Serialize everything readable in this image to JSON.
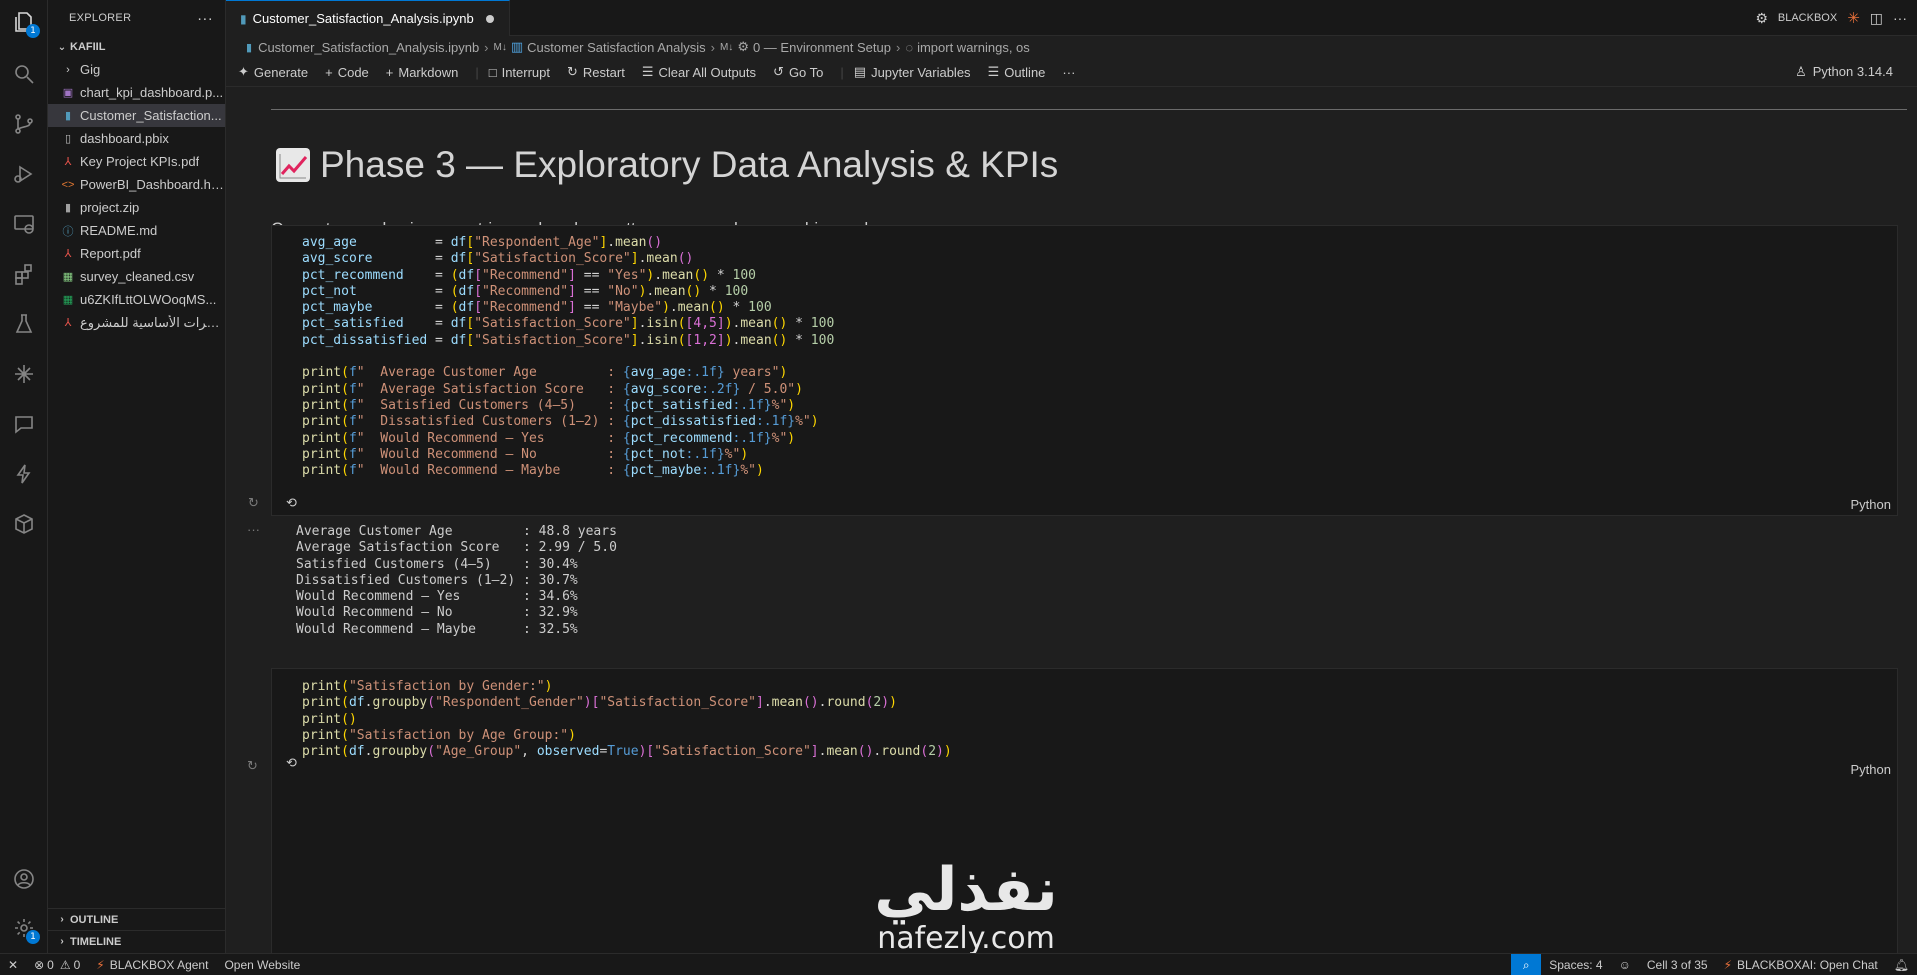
{
  "sidebar": {
    "title": "EXPLORER",
    "section": "KAFIIL",
    "items": [
      {
        "name": "Gig",
        "type": "folder"
      },
      {
        "name": "chart_kpi_dashboard.p...",
        "type": "image"
      },
      {
        "name": "Customer_Satisfaction...",
        "type": "notebook",
        "selected": true
      },
      {
        "name": "dashboard.pbix",
        "type": "file"
      },
      {
        "name": "Key Project KPIs.pdf",
        "type": "pdf"
      },
      {
        "name": "PowerBI_Dashboard.ht...",
        "type": "html"
      },
      {
        "name": "project.zip",
        "type": "zip"
      },
      {
        "name": "README.md",
        "type": "info"
      },
      {
        "name": "Report.pdf",
        "type": "pdf"
      },
      {
        "name": "survey_cleaned.csv",
        "type": "csv"
      },
      {
        "name": "u6ZKIfLttOLWOoqMS...",
        "type": "xlsx"
      },
      {
        "name": "مؤشرات الأساسية للمشروع",
        "type": "pdf"
      }
    ],
    "outline": "OUTLINE",
    "timeline": "TIMELINE"
  },
  "activity_badges": {
    "explorer": "1",
    "settings": "1"
  },
  "tab": {
    "title": "Customer_Satisfaction_Analysis.ipynb"
  },
  "tab_right": {
    "label": "BLACKBOX"
  },
  "breadcrumb": [
    "Customer_Satisfaction_Analysis.ipynb",
    "Customer Satisfaction Analysis",
    "0 — Environment Setup",
    "import warnings, os"
  ],
  "toolbar": {
    "generate": "Generate",
    "code": "Code",
    "markdown": "Markdown",
    "interrupt": "Interrupt",
    "restart": "Restart",
    "clear": "Clear All Outputs",
    "goto": "Go To",
    "variables": "Jupyter Variables",
    "outline": "Outline",
    "more": "···",
    "kernel": "Python 3.14.4"
  },
  "markdown": {
    "heading": "Phase 3 — Exploratory Data Analysis & KPIs",
    "paragraph": "Compute core business metrics and explore patterns across demographics and scores."
  },
  "cell1": {
    "lang": "Python",
    "assign": [
      {
        "var": "avg_age         ",
        "col": "\"Respondent_Age\"",
        "tail": "mean()"
      },
      {
        "var": "avg_score       ",
        "col": "\"Satisfaction_Score\"",
        "tail": "mean()"
      }
    ],
    "pct": [
      {
        "var": "pct_recommend   ",
        "val": "\"Yes\""
      },
      {
        "var": "pct_not         ",
        "val": "\"No\""
      },
      {
        "var": "pct_maybe       ",
        "val": "\"Maybe\""
      }
    ],
    "isin": [
      {
        "var": "pct_satisfied   ",
        "list": "[4,5]"
      },
      {
        "var": "pct_dissatisfied",
        "list": "[1,2]"
      }
    ],
    "prints": [
      {
        "label": "  Average Customer Age         : ",
        "expr": "avg_age",
        "fmt": ":.1f",
        "tail": " years"
      },
      {
        "label": "  Average Satisfaction Score   : ",
        "expr": "avg_score",
        "fmt": ":.2f",
        "tail": " / 5.0"
      },
      {
        "label": "  Satisfied Customers (4–5)    : ",
        "expr": "pct_satisfied",
        "fmt": ":.1f",
        "tail": "%"
      },
      {
        "label": "  Dissatisfied Customers (1–2) : ",
        "expr": "pct_dissatisfied",
        "fmt": ":.1f",
        "tail": "%"
      },
      {
        "label": "  Would Recommend — Yes        : ",
        "expr": "pct_recommend",
        "fmt": ":.1f",
        "tail": "%"
      },
      {
        "label": "  Would Recommend — No         : ",
        "expr": "pct_not",
        "fmt": ":.1f",
        "tail": "%"
      },
      {
        "label": "  Would Recommend — Maybe      : ",
        "expr": "pct_maybe",
        "fmt": ":.1f",
        "tail": "%"
      }
    ]
  },
  "output1": [
    "Average Customer Age         : 48.8 years",
    "Average Satisfaction Score   : 2.99 / 5.0",
    "Satisfied Customers (4–5)    : 30.4%",
    "Dissatisfied Customers (1–2) : 30.7%",
    "Would Recommend — Yes        : 34.6%",
    "Would Recommend — No         : 32.9%",
    "Would Recommend — Maybe      : 32.5%"
  ],
  "cell2": {
    "lang": "Python",
    "line1": "\"Satisfaction by Gender:\"",
    "line2_col": "\"Respondent_Gender\"",
    "line2_val": "\"Satisfaction_Score\"",
    "line4": "\"Satisfaction by Age Group:\"",
    "line5_col": "\"Age_Group\"",
    "line5_val": "\"Satisfaction_Score\""
  },
  "watermark": {
    "arabic": "نفذلي",
    "latin": "nafezly.com"
  },
  "status": {
    "problems_err": "0",
    "problems_warn": "0",
    "agent": "BLACKBOX Agent",
    "website": "Open Website",
    "spaces": "Spaces: 4",
    "cell": "Cell 3 of 35",
    "chat": "BLACKBOXAI: Open Chat"
  }
}
